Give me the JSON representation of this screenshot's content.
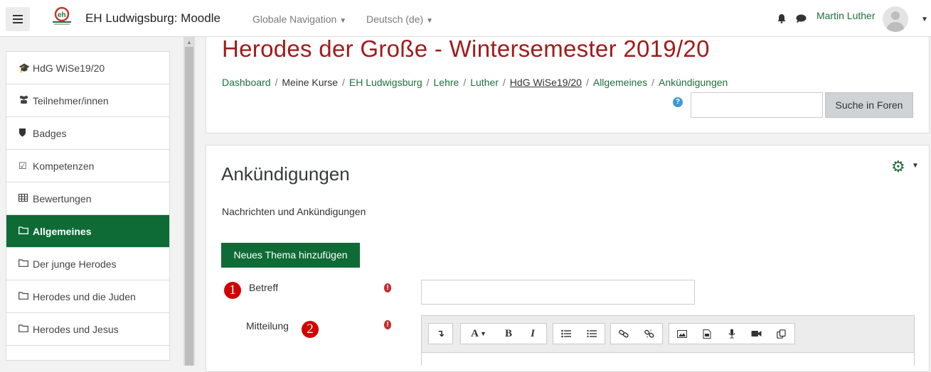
{
  "navbar": {
    "site_name": "EH Ludwigsburg: Moodle",
    "global_nav": "Globale Navigation",
    "language": "Deutsch (de)",
    "user_name": "Martin Luther",
    "brand_color": "#0e6b36"
  },
  "sidebar": {
    "items": [
      {
        "label": "HdG WiSe19/20",
        "icon": "graduation-cap-icon"
      },
      {
        "label": "Teilnehmer/innen",
        "icon": "users-icon"
      },
      {
        "label": "Badges",
        "icon": "shield-icon"
      },
      {
        "label": "Kompetenzen",
        "icon": "checkbox-icon"
      },
      {
        "label": "Bewertungen",
        "icon": "table-icon"
      },
      {
        "label": "Allgemeines",
        "icon": "folder-icon",
        "active": true
      },
      {
        "label": "Der junge Herodes",
        "icon": "folder-icon"
      },
      {
        "label": "Herodes und die Juden",
        "icon": "folder-icon"
      },
      {
        "label": "Herodes und Jesus",
        "icon": "folder-icon"
      }
    ]
  },
  "header": {
    "course_title": "Herodes der Große - Wintersemester 2019/20",
    "breadcrumb": [
      "Dashboard",
      "Meine Kurse",
      "EH Ludwigsburg",
      "Lehre",
      "Luther",
      "HdG WiSe19/20",
      "Allgemeines",
      "Ankündigungen"
    ],
    "search_button": "Suche in Foren",
    "title_color": "#a11b1b"
  },
  "main": {
    "heading": "Ankündigungen",
    "intro": "Nachrichten und Ankündigungen",
    "new_topic_button": "Neues Thema hinzufügen",
    "subject_label": "Betreff",
    "message_label": "Mitteilung",
    "annotation_1": "1",
    "annotation_2": "2"
  }
}
